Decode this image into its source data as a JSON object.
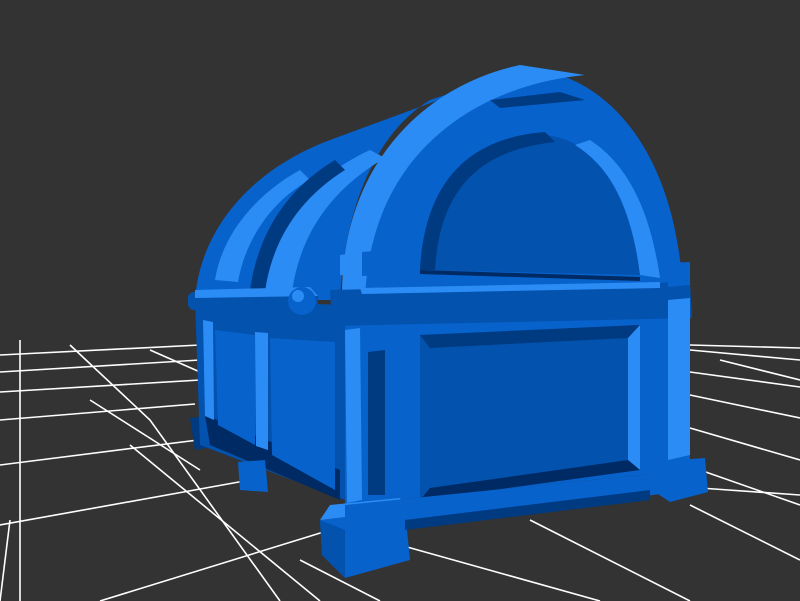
{
  "viewport": {
    "background_color": "#333333",
    "grid_color": "#ffffff",
    "grid_visible": true
  },
  "model": {
    "object": "treasure-chest",
    "shape": "barrel-lid chest with banded trim, front panel and clasp bar",
    "colors": {
      "base": "#0762cc",
      "dark": "#0352ad",
      "shadow": "#003a80",
      "deep": "#002a63",
      "light": "#2c8cf5",
      "highlight": "#3aa0ff"
    }
  }
}
